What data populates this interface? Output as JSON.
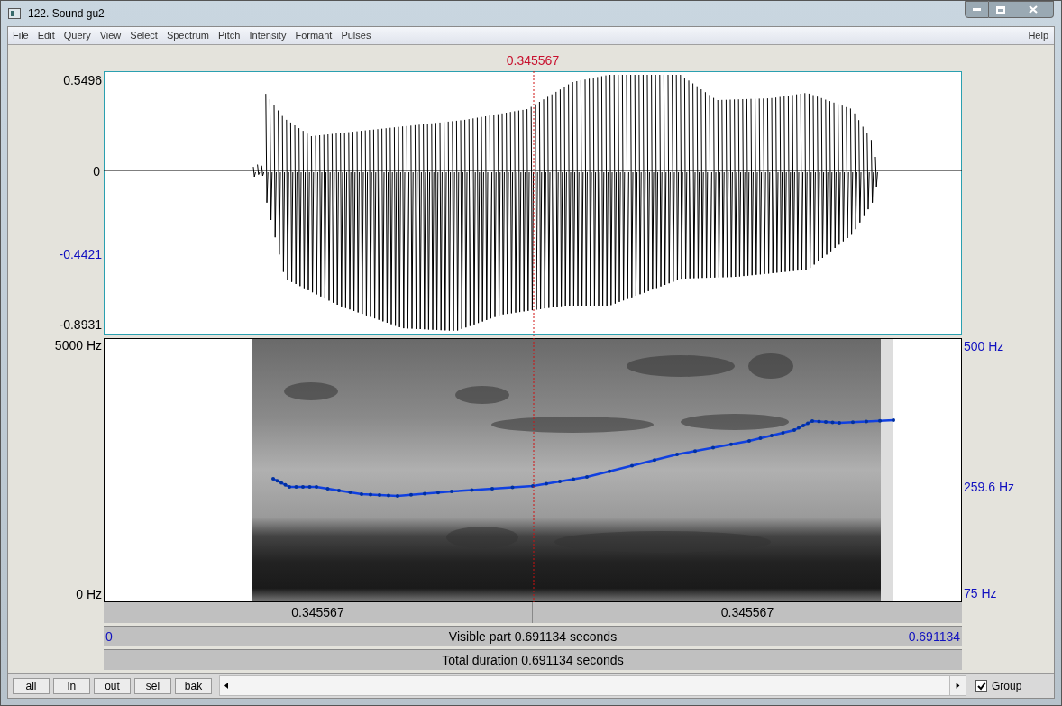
{
  "window": {
    "title": "122. Sound gu2"
  },
  "menu": [
    "File",
    "Edit",
    "Query",
    "View",
    "Select",
    "Spectrum",
    "Pitch",
    "Intensity",
    "Formant",
    "Pulses"
  ],
  "help_menu": "Help",
  "cursor": {
    "time": "0.345567"
  },
  "waveform": {
    "axis_max": "0.5496",
    "axis_zero": "0",
    "axis_marker": "-0.4421",
    "axis_min": "-0.8931"
  },
  "spectrogram": {
    "freq_max": "5000 Hz",
    "freq_min": "0 Hz"
  },
  "pitch": {
    "max": "500 Hz",
    "current": "259.6 Hz",
    "min": "75 Hz"
  },
  "segments": [
    "0.345567",
    "0.345567"
  ],
  "visible": {
    "start": "0",
    "label": "Visible part 0.691134 seconds",
    "end": "0.691134"
  },
  "total": "Total duration 0.691134 seconds",
  "buttons": [
    "all",
    "in",
    "out",
    "sel",
    "bak"
  ],
  "group": {
    "label": "Group",
    "checked": true
  }
}
